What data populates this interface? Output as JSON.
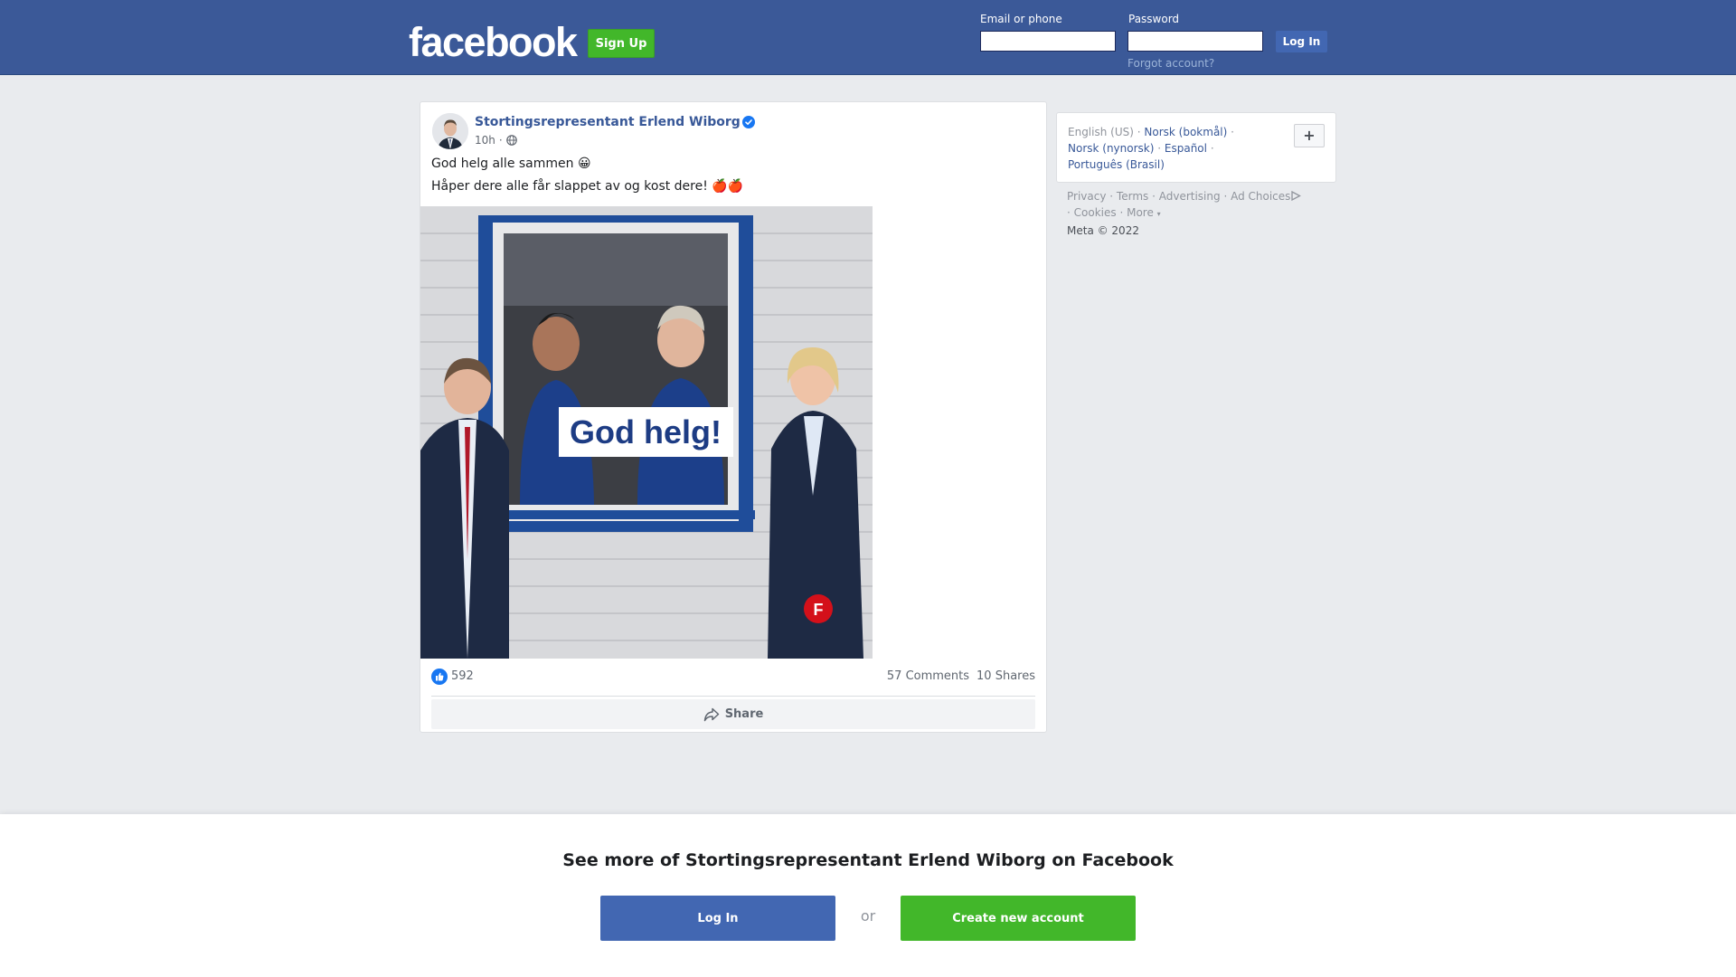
{
  "header": {
    "logo_text": "facebook",
    "signup_label": "Sign Up",
    "email_label": "Email or phone",
    "email_value": "",
    "password_label": "Password",
    "password_value": "",
    "login_label": "Log In",
    "forgot_label": "Forgot account?"
  },
  "post": {
    "author": "Stortingsrepresentant Erlend Wiborg",
    "verified": true,
    "time": "10h",
    "privacy_icon": "globe-icon",
    "text_line1": "God helg alle sammen 😀",
    "text_line2": "Håper dere alle får slappet av og kost dere! 🍎🍎",
    "image_caption": "God helg!",
    "likes": "592",
    "comments": "57 Comments",
    "shares": "10 Shares",
    "share_label": "Share"
  },
  "languages": {
    "current": "English (US)",
    "options": [
      "Norsk (bokmål)",
      "Norsk (nynorsk)",
      "Español",
      "Português (Brasil)"
    ],
    "add_icon": "plus-icon"
  },
  "footer": {
    "links": [
      "Privacy",
      "Terms",
      "Advertising",
      "Ad Choices",
      "Cookies",
      "More"
    ],
    "copyright": "Meta © 2022"
  },
  "banner": {
    "title": "See more of Stortingsrepresentant Erlend Wiborg on Facebook",
    "login_label": "Log In",
    "or_label": "or",
    "create_label": "Create new account"
  },
  "colors": {
    "brand_blue": "#3b5998",
    "button_blue": "#4267b2",
    "green": "#42b72a",
    "link": "#385898"
  }
}
